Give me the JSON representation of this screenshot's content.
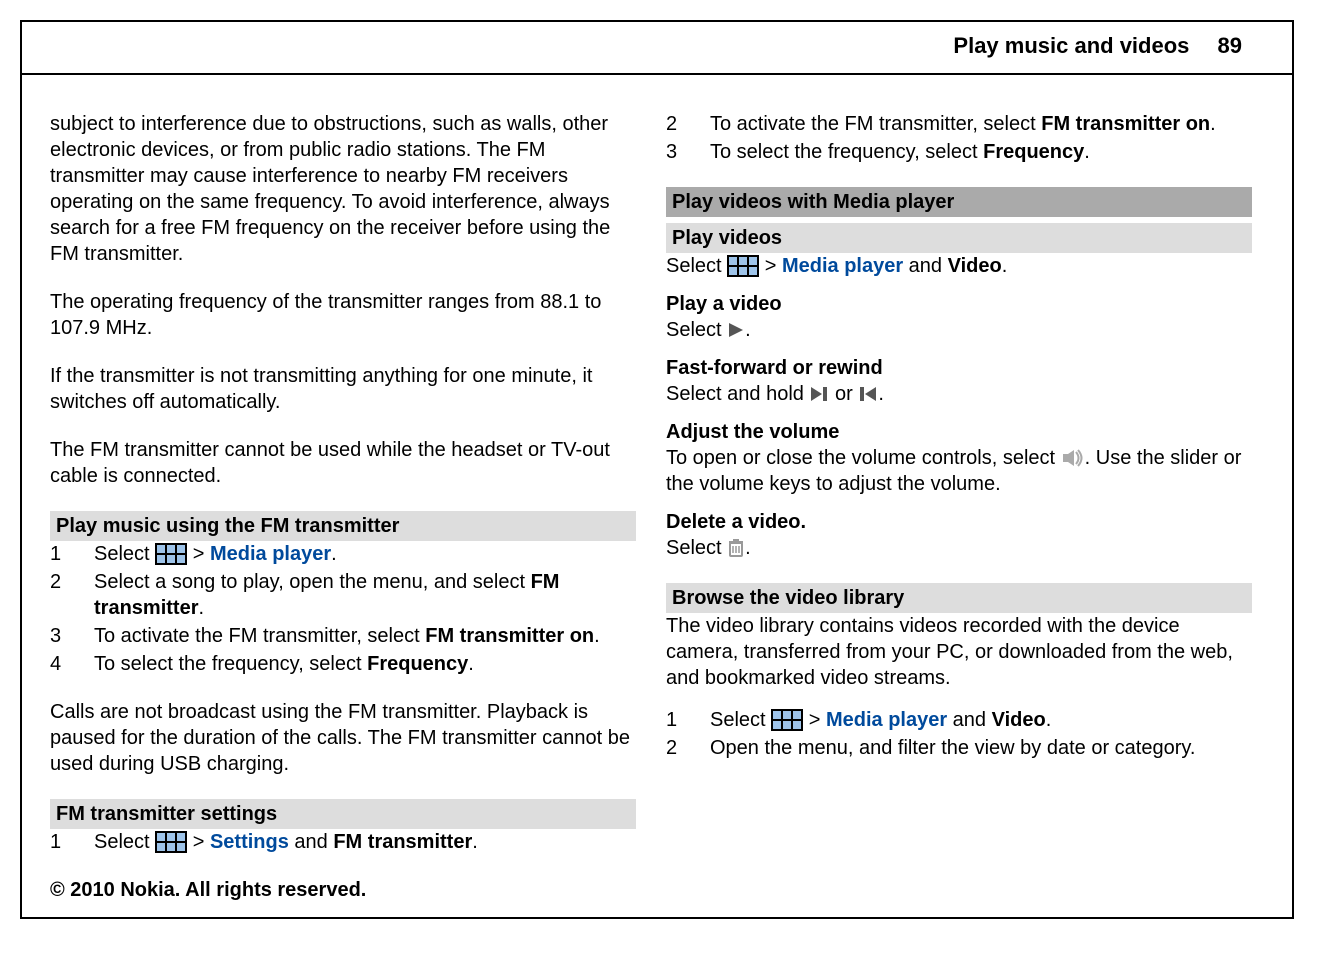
{
  "header": {
    "title": "Play music and videos",
    "page": "89"
  },
  "left": {
    "p1": "subject to interference due to obstructions, such as walls, other electronic devices, or from public radio stations. The FM transmitter may cause interference to nearby FM receivers operating on the same frequency. To avoid interference, always search for a free FM frequency on the receiver before using the FM transmitter.",
    "p2": "The operating frequency of the transmitter ranges from 88.1 to 107.9 MHz.",
    "p3": "If the transmitter is not transmitting anything for one minute, it switches off automatically.",
    "p4": "The FM transmitter cannot be used while the headset or TV-out cable is connected.",
    "sec1_title": "Play music using the FM transmitter",
    "sec1_items": {
      "n1": "1",
      "i1_a": "Select ",
      "i1_b": " > ",
      "i1_link": "Media player",
      "i1_c": ".",
      "n2": "2",
      "i2_a": "Select a song to play, open the menu, and select ",
      "i2_bold": "FM transmitter",
      "i2_b": ".",
      "n3": "3",
      "i3_a": "To activate the FM transmitter, select ",
      "i3_bold": "FM transmitter on",
      "i3_b": ".",
      "n4": "4",
      "i4_a": "To select the frequency, select ",
      "i4_bold": "Frequency",
      "i4_b": "."
    },
    "p5": "Calls are not broadcast using the FM transmitter. Playback is paused for the duration of the calls. The FM transmitter cannot be used during USB charging.",
    "sec2_title": "FM transmitter settings",
    "sec2_items": {
      "n1": "1",
      "i1_a": "Select ",
      "i1_b": " > ",
      "i1_link": "Settings",
      "i1_c": " and ",
      "i1_bold": "FM transmitter",
      "i1_d": "."
    }
  },
  "right": {
    "cont_items": {
      "n2": "2",
      "i2_a": "To activate the FM transmitter, select ",
      "i2_bold": "FM transmitter on",
      "i2_b": ".",
      "n3": "3",
      "i3_a": "To select the frequency, select ",
      "i3_bold": "Frequency",
      "i3_b": "."
    },
    "sec1_title": "Play videos with Media player",
    "sec1_sub": "Play videos",
    "sec1_line_a": "Select ",
    "sec1_line_b": " > ",
    "sec1_link": "Media player",
    "sec1_line_c": " and ",
    "sec1_bold": "Video",
    "sec1_line_d": ".",
    "sub2": "Play a video",
    "sub2_line_a": "Select ",
    "sub2_line_b": ".",
    "sub3": "Fast-forward or rewind",
    "sub3_line_a": "Select and hold ",
    "sub3_line_b": " or ",
    "sub3_line_c": ".",
    "sub4": "Adjust the volume",
    "sub4_line_a": "To open or close the volume controls, select ",
    "sub4_line_b": ". Use the slider or the volume keys to adjust the volume.",
    "sub5": "Delete a video.",
    "sub5_line_a": "Select ",
    "sub5_line_b": ".",
    "sec2_title": "Browse the video library",
    "sec2_p": "The video library contains videos recorded with the device camera, transferred from your PC, or downloaded from the web, and bookmarked video streams.",
    "sec2_items": {
      "n1": "1",
      "i1_a": "Select ",
      "i1_b": " > ",
      "i1_link": "Media player",
      "i1_c": " and ",
      "i1_bold": "Video",
      "i1_d": ".",
      "n2": "2",
      "i2": "Open the menu, and filter the view by date or category."
    }
  },
  "footer": "© 2010 Nokia. All rights reserved."
}
